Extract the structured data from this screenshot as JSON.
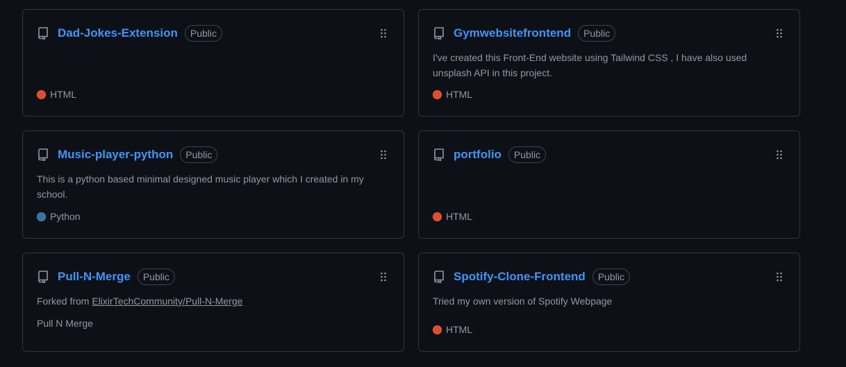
{
  "colors": {
    "background": "#0d1117",
    "border": "#30363d",
    "link": "#4493f8",
    "muted": "#9198a1",
    "html_lang": "#e34c26",
    "python_lang": "#3572A5"
  },
  "repos": [
    {
      "name": "Dad-Jokes-Extension",
      "visibility": "Public",
      "description": "",
      "language": "HTML"
    },
    {
      "name": "Gymwebsitefrontend",
      "visibility": "Public",
      "description": "I've created this Front-End website using Tailwind CSS , I have also used unsplash API in this project.",
      "language": "HTML"
    },
    {
      "name": "Music-player-python",
      "visibility": "Public",
      "description": "This is a python based minimal designed music player which I created in my school.",
      "language": "Python"
    },
    {
      "name": "portfolio",
      "visibility": "Public",
      "description": "",
      "language": "HTML"
    },
    {
      "name": "Pull-N-Merge",
      "visibility": "Public",
      "forked_prefix": "Forked from",
      "forked_from": "ElixirTechCommunity/Pull-N-Merge",
      "description": "Pull N Merge"
    },
    {
      "name": "Spotify-Clone-Frontend",
      "visibility": "Public",
      "description": "Tried my own version of Spotify Webpage",
      "language": "HTML"
    }
  ]
}
